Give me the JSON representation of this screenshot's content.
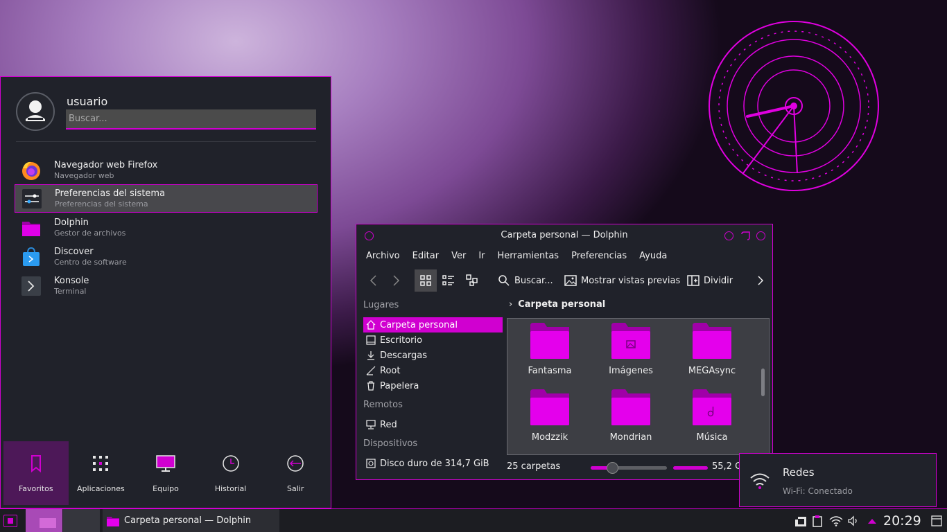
{
  "launcher": {
    "username": "usuario",
    "search_placeholder": "Buscar...",
    "apps": [
      {
        "name": "Navegador web Firefox",
        "desc": "Navegador web"
      },
      {
        "name": "Preferencias del sistema",
        "desc": "Preferencias del sistema"
      },
      {
        "name": "Dolphin",
        "desc": "Gestor de archivos"
      },
      {
        "name": "Discover",
        "desc": "Centro de software"
      },
      {
        "name": "Konsole",
        "desc": "Terminal"
      }
    ],
    "tabs": [
      "Favoritos",
      "Aplicaciones",
      "Equipo",
      "Historial",
      "Salir"
    ],
    "active_tab": "Favoritos"
  },
  "dolphin": {
    "title": "Carpeta personal — Dolphin",
    "menu": [
      "Archivo",
      "Editar",
      "Ver",
      "Ir",
      "Herramientas",
      "Preferencias",
      "Ayuda"
    ],
    "toolbar": {
      "search": "Buscar...",
      "previews": "Mostrar vistas previas",
      "split": "Dividir"
    },
    "places": {
      "places_header": "Lugares",
      "items": [
        "Carpeta personal",
        "Escritorio",
        "Descargas",
        "Root",
        "Papelera"
      ],
      "remote_header": "Remotos",
      "remote_items": [
        "Red"
      ],
      "devices_header": "Dispositivos",
      "device_items": [
        "Disco duro de 314,7 GiB"
      ]
    },
    "breadcrumb": "Carpeta personal",
    "folders": [
      "Fantasma",
      "Imágenes",
      "MEGAsync",
      "Modzzik",
      "Mondrian",
      "Música"
    ],
    "status": {
      "count": "25 carpetas",
      "free": "55,2 G"
    }
  },
  "notification": {
    "title": "Redes",
    "body": "Wi-Fi: Conectado"
  },
  "taskbar": {
    "task_title": "Carpeta personal — Dolphin",
    "clock": "20:29"
  },
  "colors": {
    "accent": "#d000d0",
    "panel": "#20222a",
    "selected": "#48484c"
  }
}
